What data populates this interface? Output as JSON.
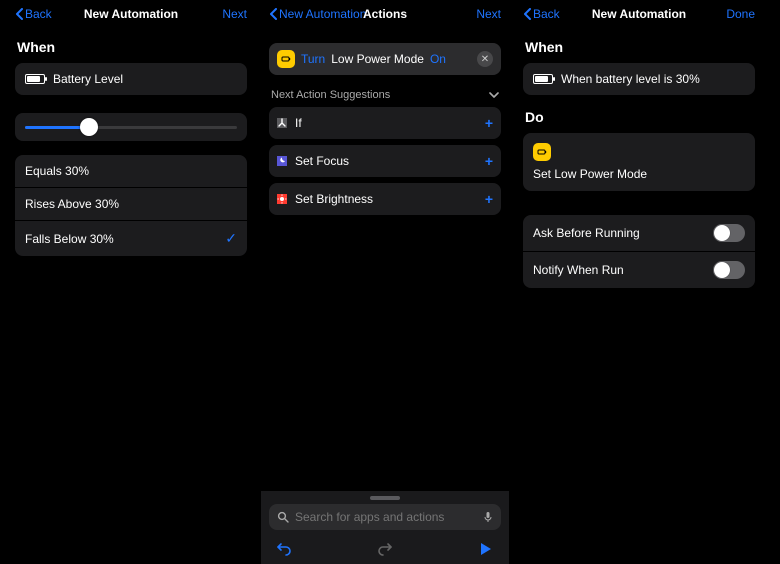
{
  "pane1": {
    "back": "Back",
    "title": "New Automation",
    "next": "Next",
    "section_when": "When",
    "trigger": "Battery Level",
    "slider_percent": 30,
    "options": [
      {
        "label": "Equals 30%",
        "selected": false
      },
      {
        "label": "Rises Above 30%",
        "selected": false
      },
      {
        "label": "Falls Below 30%",
        "selected": true
      }
    ]
  },
  "pane2": {
    "back": "New Automation",
    "title": "Actions",
    "next": "Next",
    "action": {
      "verb": "Turn",
      "subject": "Low Power Mode",
      "value": "On"
    },
    "suggest_header": "Next Action Suggestions",
    "suggestions": [
      {
        "label": "If",
        "color": "gray"
      },
      {
        "label": "Set Focus",
        "color": "purple"
      },
      {
        "label": "Set Brightness",
        "color": "red"
      }
    ],
    "search_placeholder": "Search for apps and actions"
  },
  "pane3": {
    "back": "Back",
    "title": "New Automation",
    "done": "Done",
    "section_when": "When",
    "when_text": "When battery level is 30%",
    "section_do": "Do",
    "do_text": "Set Low Power Mode",
    "toggles": [
      {
        "label": "Ask Before Running",
        "on": false
      },
      {
        "label": "Notify When Run",
        "on": false
      }
    ]
  }
}
